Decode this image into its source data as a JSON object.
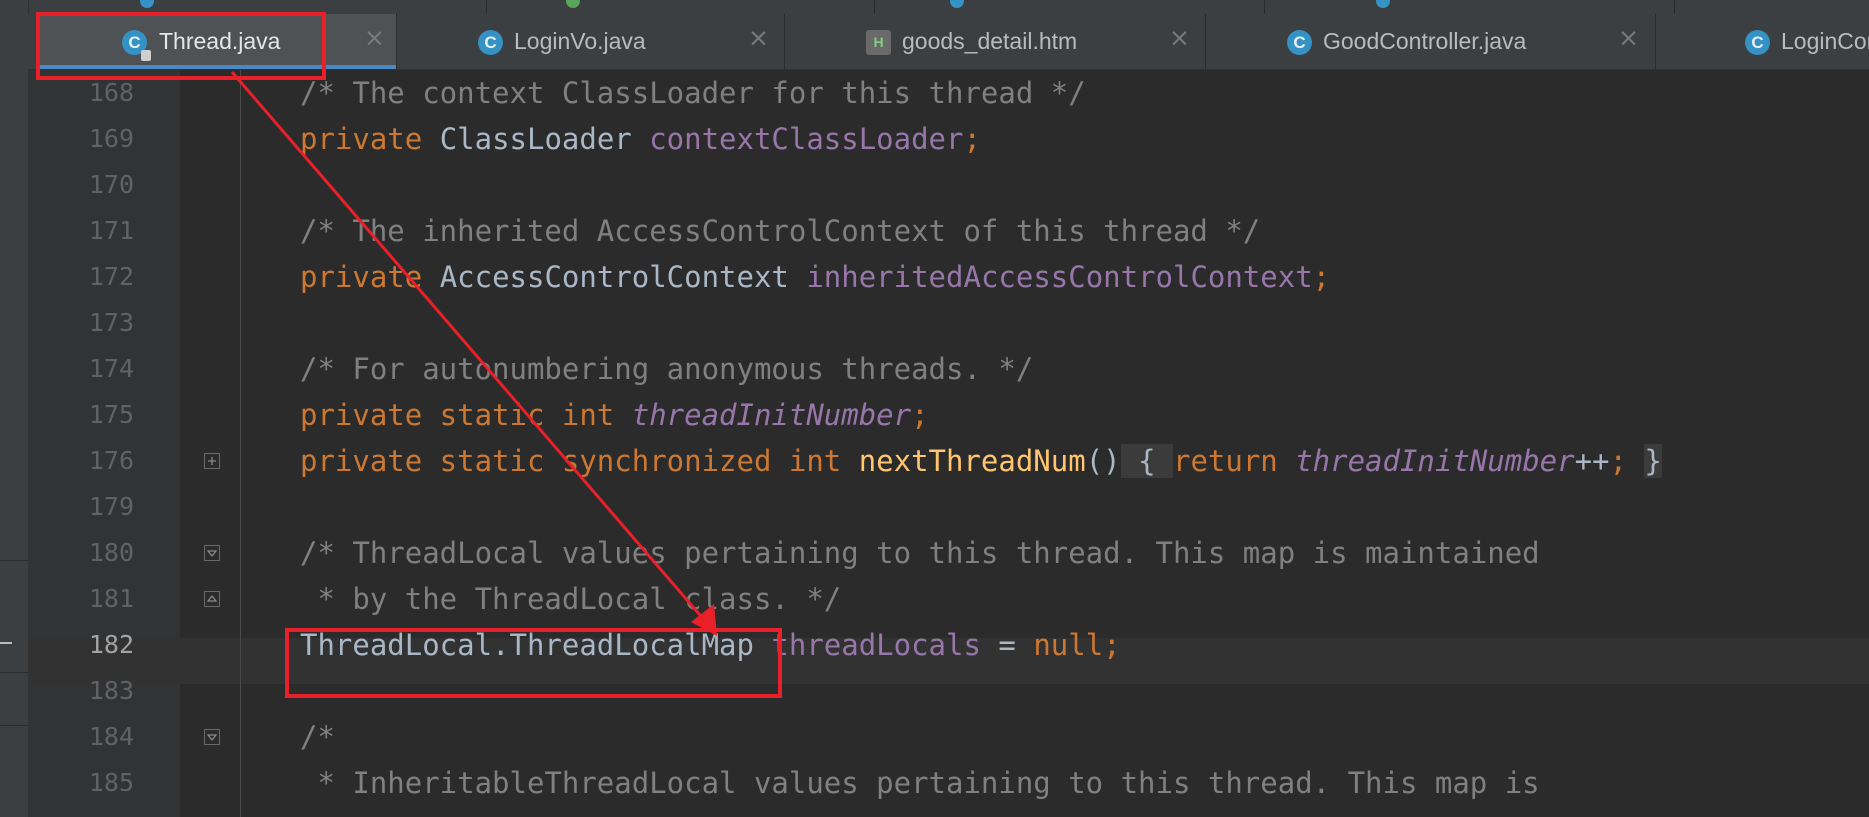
{
  "tabs": [
    {
      "label": "Thread.java",
      "icon": "class-icon",
      "active": true,
      "locked": true
    },
    {
      "label": "LoginVo.java",
      "icon": "class-icon",
      "active": false
    },
    {
      "label": "goods_detail.htm",
      "icon": "html-file-icon",
      "active": false
    },
    {
      "label": "GoodController.java",
      "icon": "class-icon",
      "active": false
    },
    {
      "label": "LoginCont",
      "icon": "class-icon",
      "active": false
    }
  ],
  "icons": {
    "class_glyph": "C",
    "html_glyph": "H",
    "close_glyph": "×"
  },
  "editor": {
    "current_line": "182",
    "lines": [
      {
        "num": "168",
        "tokens": [
          {
            "t": "/* The context ClassLoader for this thread */",
            "c": "com"
          }
        ]
      },
      {
        "num": "169",
        "tokens": [
          {
            "t": "private ",
            "c": "kw"
          },
          {
            "t": "ClassLoader ",
            "c": "ty"
          },
          {
            "t": "contextClassLoader",
            "c": "field"
          },
          {
            "t": ";",
            "c": "kw"
          }
        ]
      },
      {
        "num": "170",
        "tokens": []
      },
      {
        "num": "171",
        "tokens": [
          {
            "t": "/* The inherited AccessControlContext of this thread */",
            "c": "com"
          }
        ]
      },
      {
        "num": "172",
        "tokens": [
          {
            "t": "private ",
            "c": "kw"
          },
          {
            "t": "AccessControlContext ",
            "c": "ty"
          },
          {
            "t": "inheritedAccessControlContext",
            "c": "field"
          },
          {
            "t": ";",
            "c": "kw"
          }
        ]
      },
      {
        "num": "173",
        "tokens": []
      },
      {
        "num": "174",
        "tokens": [
          {
            "t": "/* For autonumbering anonymous threads. */",
            "c": "com"
          }
        ]
      },
      {
        "num": "175",
        "tokens": [
          {
            "t": "private static int ",
            "c": "kw"
          },
          {
            "t": "threadInitNumber",
            "c": "fi"
          },
          {
            "t": ";",
            "c": "kw"
          }
        ]
      },
      {
        "num": "176",
        "fold": "plus",
        "tokens": [
          {
            "t": "private static synchronized int ",
            "c": "kw"
          },
          {
            "t": "nextThreadNum",
            "c": "fn"
          },
          {
            "t": "()",
            "c": "ty"
          },
          {
            "t": " { ",
            "c": "brace"
          },
          {
            "t": "return ",
            "c": "kw"
          },
          {
            "t": "threadInitNumber",
            "c": "fi"
          },
          {
            "t": "++",
            "c": "ty"
          },
          {
            "t": "; ",
            "c": "kw"
          },
          {
            "t": "}",
            "c": "brace"
          }
        ]
      },
      {
        "num": "179",
        "tokens": []
      },
      {
        "num": "180",
        "fold": "open",
        "tokens": [
          {
            "t": "/* ThreadLocal values pertaining to this thread. This map is maintained",
            "c": "com"
          }
        ]
      },
      {
        "num": "181",
        "fold": "close",
        "tokens": [
          {
            "t": " * by the ThreadLocal class. */",
            "c": "com"
          }
        ]
      },
      {
        "num": "182",
        "tokens": [
          {
            "t": "ThreadLocal.ThreadLocalMap ",
            "c": "ty"
          },
          {
            "t": "threadLocals",
            "c": "field"
          },
          {
            "t": " = ",
            "c": "ty"
          },
          {
            "t": "null",
            "c": "kw"
          },
          {
            "t": ";",
            "c": "kw"
          }
        ]
      },
      {
        "num": "183",
        "tokens": []
      },
      {
        "num": "184",
        "fold": "open",
        "tokens": [
          {
            "t": "/*",
            "c": "com"
          }
        ]
      },
      {
        "num": "185",
        "tokens": [
          {
            "t": " * InheritableThreadLocal values pertaining to this thread. This map is",
            "c": "com"
          }
        ]
      }
    ]
  },
  "colors": {
    "annotation": "#e8202a",
    "keyword": "#cc7832",
    "comment": "#808080",
    "field": "#9876aa",
    "method": "#ffc66d",
    "text": "#a9b7c6",
    "background": "#2b2b2b",
    "tab_accent": "#4a88c7"
  }
}
